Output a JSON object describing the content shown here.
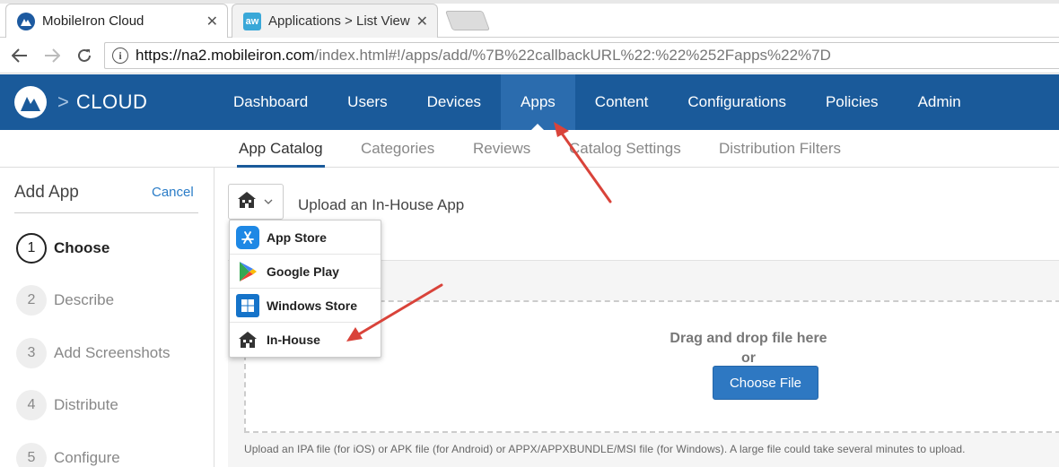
{
  "browser": {
    "tabs": [
      {
        "title": "MobileIron Cloud",
        "active": true
      },
      {
        "title": "Applications > List View",
        "favicon_text": "aw",
        "active": false
      }
    ],
    "close_glyph": "✕",
    "url_host": "https://na2.mobileiron.com",
    "url_rest": "/index.html#!/apps/add/%7B%22callbackURL%22:%22%252Fapps%22%7D"
  },
  "header": {
    "brand_separator": ">",
    "brand_text": "CLOUD",
    "nav": [
      "Dashboard",
      "Users",
      "Devices",
      "Apps",
      "Content",
      "Configurations",
      "Policies",
      "Admin"
    ],
    "active_nav": "Apps",
    "accent_color": "#1a5a9a"
  },
  "subnav": {
    "items": [
      "App Catalog",
      "Categories",
      "Reviews",
      "Catalog Settings",
      "Distribution Filters"
    ],
    "active": "App Catalog"
  },
  "sidebar": {
    "title": "Add App",
    "cancel_label": "Cancel",
    "steps": [
      {
        "num": "1",
        "label": "Choose",
        "active": true
      },
      {
        "num": "2",
        "label": "Describe",
        "active": false
      },
      {
        "num": "3",
        "label": "Add Screenshots",
        "active": false
      },
      {
        "num": "4",
        "label": "Distribute",
        "active": false
      },
      {
        "num": "5",
        "label": "Configure",
        "active": false
      }
    ]
  },
  "main": {
    "upload_title": "Upload an In-House App",
    "dropzone_line1": "Drag and drop file here",
    "dropzone_line2": "or",
    "choose_button": "Choose File",
    "help_text": "Upload an IPA file (for iOS) or APK file (for Android) or APPX/APPXBUNDLE/MSI file (for Windows). A large file could take several minutes to upload."
  },
  "dropdown": {
    "items": [
      {
        "label": "App Store",
        "icon": "app-store-icon"
      },
      {
        "label": "Google Play",
        "icon": "google-play-icon"
      },
      {
        "label": "Windows Store",
        "icon": "windows-icon"
      },
      {
        "label": "In-House",
        "icon": "building-icon"
      }
    ]
  },
  "annotation_color": "#d9433a"
}
